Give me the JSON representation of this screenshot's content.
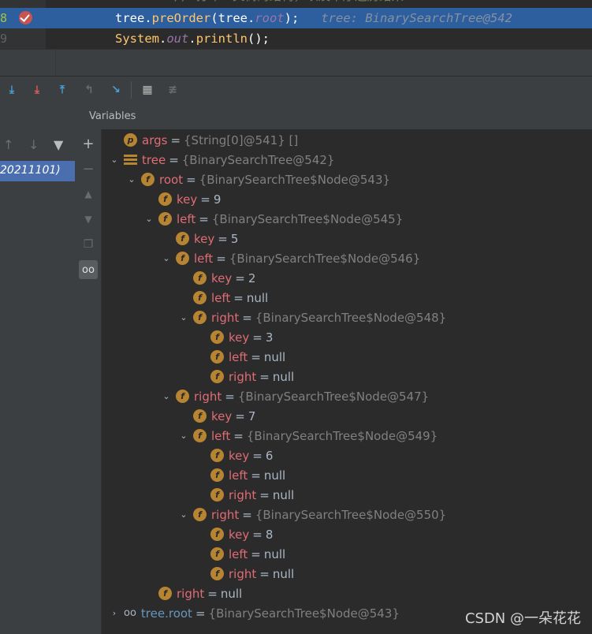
{
  "editor": {
    "cut_line": "        // 打印二叉树的结构，以及中序遍历结果",
    "line8": {
      "number": "8",
      "code": {
        "obj1": "tree",
        "dot1": ".",
        "method": "preOrder",
        "paren_open": "(",
        "obj2": "tree",
        "dot2": ".",
        "field": "root",
        "paren_close": ");"
      },
      "hint": "tree: BinarySearchTree@542"
    },
    "line9": {
      "number": "9",
      "code": {
        "cls": "System",
        "dot1": ".",
        "field": "out",
        "dot2": ".",
        "method": "println",
        "rest": "();"
      }
    }
  },
  "toolbar": {
    "icons": [
      "step-over-icon",
      "step-into-icon",
      "force-step-into-icon",
      "step-out-icon",
      "drop-frame-icon",
      "run-to-cursor-icon",
      "evaluate-expression-icon",
      "trace-icon"
    ]
  },
  "frames": {
    "selected_frame": "20211101)"
  },
  "variables": {
    "header": "Variables",
    "rows": [
      {
        "indent": 0,
        "arrow": "",
        "badge": "p",
        "name": "args",
        "value": "{String[0]@541} []",
        "obj": true
      },
      {
        "indent": 0,
        "arrow": "v",
        "badge": "list",
        "name": "tree",
        "value": "{BinarySearchTree@542}",
        "obj": true
      },
      {
        "indent": 1,
        "arrow": "v",
        "badge": "f",
        "name": "root",
        "value": "{BinarySearchTree$Node@543}",
        "obj": true
      },
      {
        "indent": 2,
        "arrow": "",
        "badge": "f",
        "name": "key",
        "value": "9",
        "obj": false
      },
      {
        "indent": 2,
        "arrow": "v",
        "badge": "f",
        "name": "left",
        "value": "{BinarySearchTree$Node@545}",
        "obj": true
      },
      {
        "indent": 3,
        "arrow": "",
        "badge": "f",
        "name": "key",
        "value": "5",
        "obj": false
      },
      {
        "indent": 3,
        "arrow": "v",
        "badge": "f",
        "name": "left",
        "value": "{BinarySearchTree$Node@546}",
        "obj": true
      },
      {
        "indent": 4,
        "arrow": "",
        "badge": "f",
        "name": "key",
        "value": "2",
        "obj": false
      },
      {
        "indent": 4,
        "arrow": "",
        "badge": "f",
        "name": "left",
        "value": "null",
        "obj": false
      },
      {
        "indent": 4,
        "arrow": "v",
        "badge": "f",
        "name": "right",
        "value": "{BinarySearchTree$Node@548}",
        "obj": true
      },
      {
        "indent": 5,
        "arrow": "",
        "badge": "f",
        "name": "key",
        "value": "3",
        "obj": false
      },
      {
        "indent": 5,
        "arrow": "",
        "badge": "f",
        "name": "left",
        "value": "null",
        "obj": false
      },
      {
        "indent": 5,
        "arrow": "",
        "badge": "f",
        "name": "right",
        "value": "null",
        "obj": false
      },
      {
        "indent": 3,
        "arrow": "v",
        "badge": "f",
        "name": "right",
        "value": "{BinarySearchTree$Node@547}",
        "obj": true
      },
      {
        "indent": 4,
        "arrow": "",
        "badge": "f",
        "name": "key",
        "value": "7",
        "obj": false
      },
      {
        "indent": 4,
        "arrow": "v",
        "badge": "f",
        "name": "left",
        "value": "{BinarySearchTree$Node@549}",
        "obj": true
      },
      {
        "indent": 5,
        "arrow": "",
        "badge": "f",
        "name": "key",
        "value": "6",
        "obj": false
      },
      {
        "indent": 5,
        "arrow": "",
        "badge": "f",
        "name": "left",
        "value": "null",
        "obj": false
      },
      {
        "indent": 5,
        "arrow": "",
        "badge": "f",
        "name": "right",
        "value": "null",
        "obj": false
      },
      {
        "indent": 4,
        "arrow": "v",
        "badge": "f",
        "name": "right",
        "value": "{BinarySearchTree$Node@550}",
        "obj": true
      },
      {
        "indent": 5,
        "arrow": "",
        "badge": "f",
        "name": "key",
        "value": "8",
        "obj": false
      },
      {
        "indent": 5,
        "arrow": "",
        "badge": "f",
        "name": "left",
        "value": "null",
        "obj": false
      },
      {
        "indent": 5,
        "arrow": "",
        "badge": "f",
        "name": "right",
        "value": "null",
        "obj": false
      },
      {
        "indent": 2,
        "arrow": "",
        "badge": "f",
        "name": "right",
        "value": "null",
        "obj": false
      },
      {
        "indent": 0,
        "arrow": ">",
        "badge": "watch",
        "name": "tree.root",
        "value": "{BinarySearchTree$Node@543}",
        "obj": true,
        "blue": true
      }
    ]
  },
  "watermark": "CSDN @一朵花花",
  "colors": {
    "selection": "#2d5f9e",
    "frame_selection": "#4b6eaf",
    "field_badge": "#b78431",
    "var_name": "#e06c75"
  }
}
